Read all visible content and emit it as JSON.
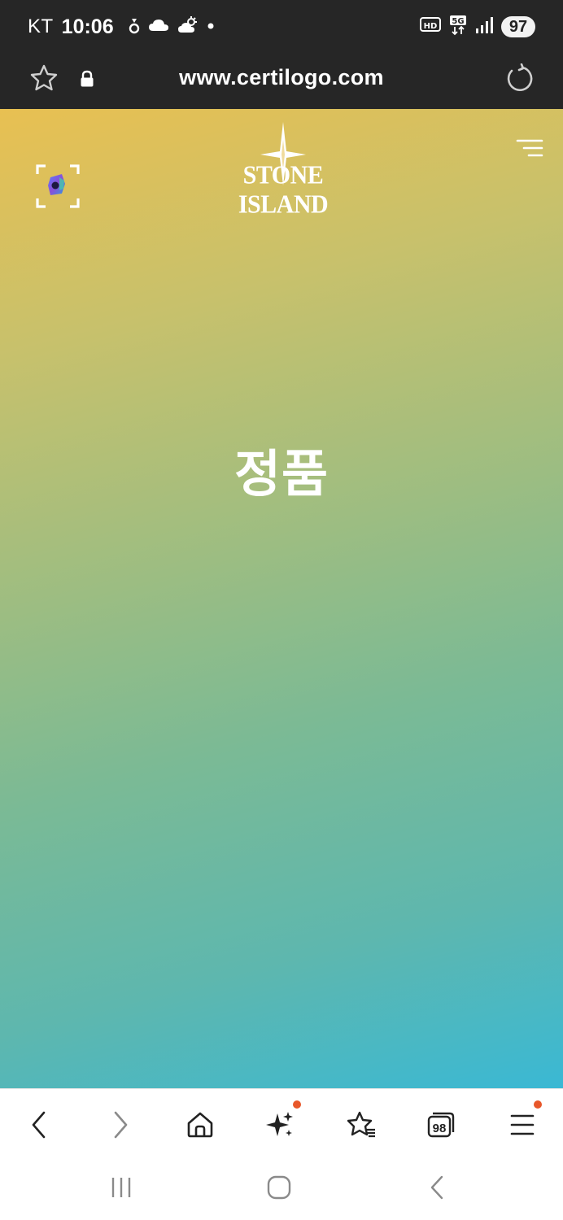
{
  "status_bar": {
    "carrier": "KT",
    "time": "10:06",
    "icons_left": [
      "notification-icon",
      "cloud-icon",
      "weather-icon",
      "dot-icon"
    ],
    "icons_right": [
      "hd-voice-icon",
      "5g-icon",
      "signal-icon"
    ],
    "battery": "97"
  },
  "url_bar": {
    "url": "www.certilogo.com",
    "icons": [
      "star-icon",
      "lock-icon",
      "reload-icon"
    ]
  },
  "page": {
    "brand": "STONE ISLAND",
    "verdict": "정품",
    "gradient": [
      "#e8c052",
      "#9cbd82",
      "#3ab8d4"
    ]
  },
  "toolbar": {
    "icons": [
      "back-icon",
      "forward-icon",
      "home-icon",
      "sparkle-icon",
      "bookmarks-icon",
      "tabs-icon",
      "menu-icon"
    ],
    "tabs_count": "98",
    "badge_color": "#e8572a"
  },
  "system_nav": {
    "icons": [
      "recents-icon",
      "home-circle-icon",
      "back-chevron-icon"
    ]
  }
}
